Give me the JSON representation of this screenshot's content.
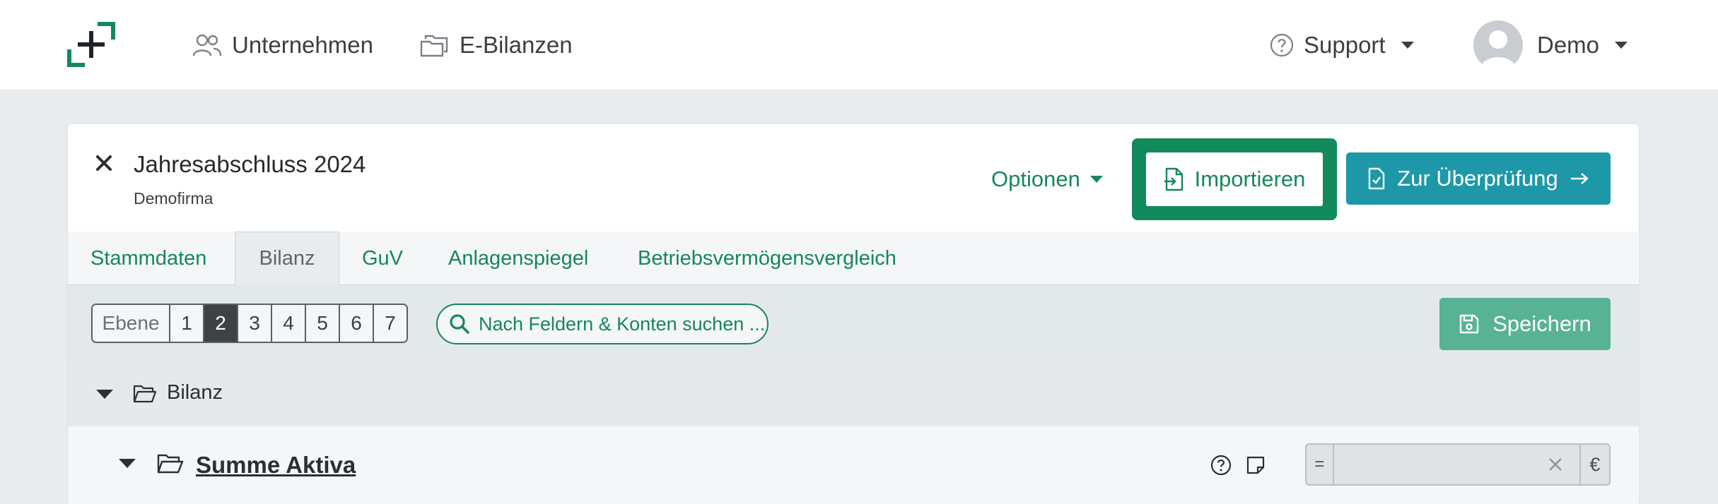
{
  "nav": {
    "companies_label": "Unternehmen",
    "ebalances_label": "E-Bilanzen",
    "support_label": "Support",
    "user_label": "Demo"
  },
  "document": {
    "title": "Jahresabschluss 2024",
    "subtitle": "Demofirma"
  },
  "actions": {
    "options_label": "Optionen",
    "import_label": "Importieren",
    "review_label": "Zur Überprüfung"
  },
  "tabs": [
    {
      "label": "Stammdaten",
      "active": false
    },
    {
      "label": "Bilanz",
      "active": true
    },
    {
      "label": "GuV",
      "active": false
    },
    {
      "label": "Anlagenspiegel",
      "active": false
    },
    {
      "label": "Betriebsvermögensvergleich",
      "active": false
    }
  ],
  "toolbar": {
    "level_label": "Ebene",
    "levels": [
      "1",
      "2",
      "3",
      "4",
      "5",
      "6",
      "7"
    ],
    "selected_level": "2",
    "search_label": "Nach Feldern & Konten suchen ...",
    "save_label": "Speichern"
  },
  "tree": {
    "root_label": "Bilanz",
    "child_label": "Summe Aktiva",
    "amount_prefix": "=",
    "amount_value": "",
    "currency": "€"
  },
  "colors": {
    "brand_green": "#138a5c",
    "link_green": "#16875a",
    "review_teal": "#1e98a8",
    "save_green": "#58b394"
  }
}
